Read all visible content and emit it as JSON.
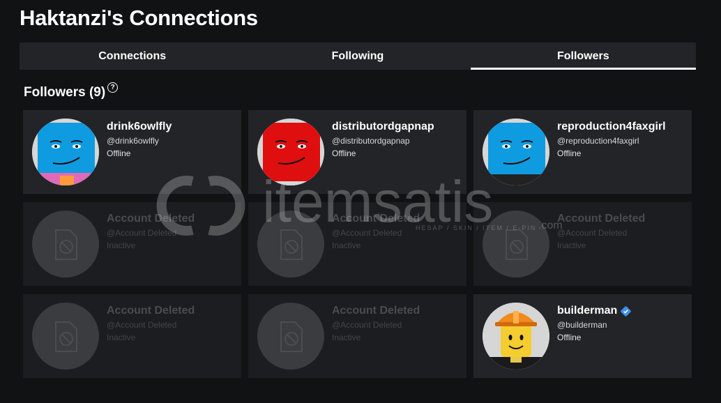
{
  "page": {
    "title": "Haktanzi's Connections"
  },
  "tabs": [
    {
      "label": "Connections",
      "active": false
    },
    {
      "label": "Following",
      "active": false
    },
    {
      "label": "Followers",
      "active": true
    }
  ],
  "section": {
    "heading": "Followers (9)",
    "help_icon": "question-circle-icon"
  },
  "cards": [
    {
      "name": "drink6owlfly",
      "handle": "@drink6owlfly",
      "status": "Offline",
      "avatar": "blue-head-avatar",
      "deleted": false
    },
    {
      "name": "distributordgapnap",
      "handle": "@distributordgapnap",
      "status": "Offline",
      "avatar": "red-head-avatar",
      "deleted": false
    },
    {
      "name": "reproduction4faxgirl",
      "handle": "@reproduction4faxgirl",
      "status": "Offline",
      "avatar": "blue-head-avatar",
      "deleted": false
    },
    {
      "name": "Account Deleted",
      "handle": "@Account Deleted",
      "status": "Inactive",
      "avatar": "deleted-file-icon",
      "deleted": true
    },
    {
      "name": "Account Deleted",
      "handle": "@Account Deleted",
      "status": "Inactive",
      "avatar": "deleted-file-icon",
      "deleted": true
    },
    {
      "name": "Account Deleted",
      "handle": "@Account Deleted",
      "status": "Inactive",
      "avatar": "deleted-file-icon",
      "deleted": true
    },
    {
      "name": "Account Deleted",
      "handle": "@Account Deleted",
      "status": "Inactive",
      "avatar": "deleted-file-icon",
      "deleted": true
    },
    {
      "name": "Account Deleted",
      "handle": "@Account Deleted",
      "status": "Inactive",
      "avatar": "deleted-file-icon",
      "deleted": true
    },
    {
      "name": "builderman",
      "handle": "@builderman",
      "status": "Offline",
      "avatar": "builderman-avatar",
      "deleted": false,
      "verified": true
    }
  ],
  "watermark": {
    "text": "itemsatis",
    "subtext": "HESAP / SKIN / ITEM / E-PIN",
    "suffix": ".com"
  },
  "colors": {
    "background": "#111214",
    "card": "#232428",
    "verified": "#3b8ff5",
    "blue_head": "#0f9be0",
    "red_head": "#e00f0f"
  }
}
